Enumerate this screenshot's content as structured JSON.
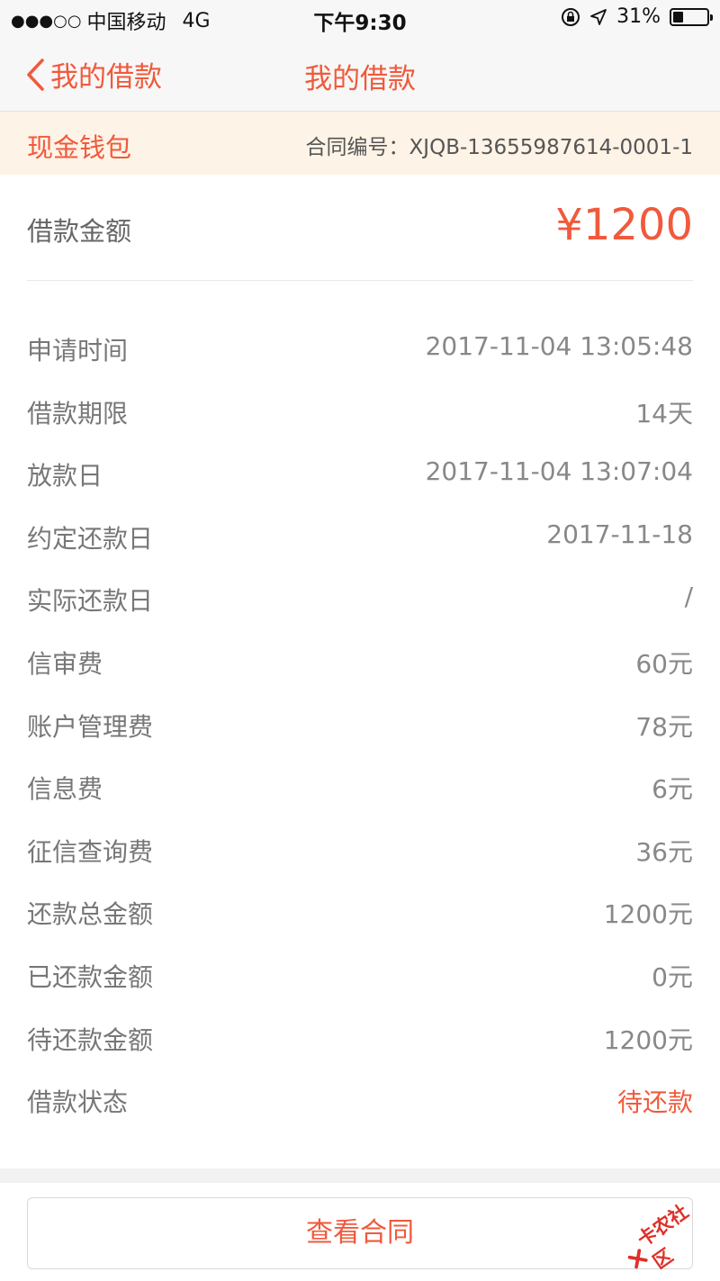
{
  "status_bar": {
    "signal_dots": "●●●○○",
    "carrier": "中国移动",
    "network": "4G",
    "time": "下午9:30",
    "battery_percent": "31%",
    "battery_level": 0.31
  },
  "nav": {
    "back_label": "我的借款",
    "title": "我的借款"
  },
  "wallet": {
    "name": "现金钱包",
    "contract_label": "合同编号：XJQB-13655987614-0001-1"
  },
  "loan_amount": {
    "label": "借款金额",
    "value": "¥1200"
  },
  "details": [
    {
      "label": "申请时间",
      "value": "2017-11-04 13:05:48"
    },
    {
      "label": "借款期限",
      "value": "14天"
    },
    {
      "label": "放款日",
      "value": "2017-11-04 13:07:04"
    },
    {
      "label": "约定还款日",
      "value": "2017-11-18"
    },
    {
      "label": "实际还款日",
      "value": "/"
    },
    {
      "label": "信审费",
      "value": "60元"
    },
    {
      "label": "账户管理费",
      "value": "78元"
    },
    {
      "label": "信息费",
      "value": "6元"
    },
    {
      "label": "征信查询费",
      "value": "36元"
    },
    {
      "label": "还款总金额",
      "value": "1200元"
    },
    {
      "label": "已还款金额",
      "value": "0元"
    },
    {
      "label": "待还款金额",
      "value": "1200元"
    },
    {
      "label": "借款状态",
      "value": "待还款"
    }
  ],
  "actions": {
    "view_contract": "查看合同"
  },
  "watermark": {
    "text": "卡农社区"
  },
  "colors": {
    "accent": "#f05a3c",
    "wallet_bg": "#fdf3e6"
  }
}
